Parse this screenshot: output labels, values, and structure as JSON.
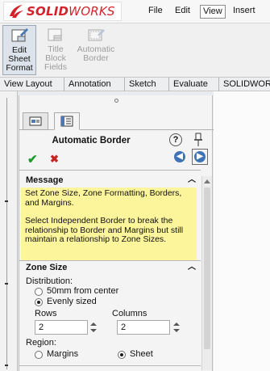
{
  "app": {
    "brand_ds": "3S",
    "brand_main": "SOLID",
    "brand_rest": "WORKS",
    "brand_color": "#d4222a"
  },
  "menu": [
    "File",
    "Edit",
    "View",
    "Insert"
  ],
  "commands": [
    {
      "line1": "Edit",
      "line2": "Sheet",
      "line3": "Format",
      "icon": "edit-sheet-format-icon"
    },
    {
      "line1": "Title",
      "line2": "Block",
      "line3": "Fields",
      "icon": "title-block-icon"
    },
    {
      "line1": "Automatic",
      "line2": "Border",
      "line3": "",
      "icon": "automatic-border-icon"
    }
  ],
  "tabs": [
    "View Layout",
    "Annotation",
    "Sketch",
    "Evaluate",
    "SOLIDWORKS"
  ],
  "panel": {
    "title": "Automatic Border",
    "help": "?",
    "message_header": "Message",
    "message_p1": "Set Zone Size, Zone Formatting, Borders, and Margins.",
    "message_p2": "Select Independent Border to break the relationship to Border and Margins but still maintain a relationship to Zone Sizes.",
    "message_bg": "#fdf59b",
    "zone_header": "Zone Size",
    "distribution_label": "Distribution:",
    "dist_options": [
      "50mm from center",
      "Evenly sized"
    ],
    "dist_selected": "Evenly sized",
    "rows_label": "Rows",
    "rows_value": "2",
    "columns_label": "Columns",
    "columns_value": "2",
    "region_label": "Region:",
    "region_options": [
      "Margins",
      "Sheet"
    ],
    "region_selected": "Sheet"
  }
}
